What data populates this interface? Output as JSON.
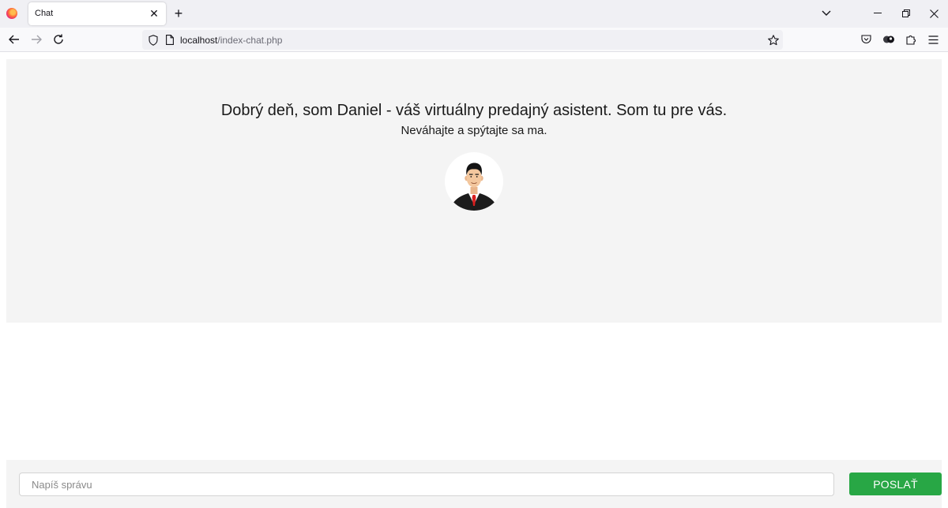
{
  "browser": {
    "tab_title": "Chat",
    "url_host": "localhost",
    "url_path": "/index-chat.php"
  },
  "chat": {
    "welcome_line1": "Dobrý deň, som Daniel - váš virtuálny predajný asistent. Som tu pre vás.",
    "welcome_line2": "Neváhajte a spýtajte sa ma."
  },
  "composer": {
    "placeholder": "Napíš správu",
    "value": "",
    "send_label": "POSLAŤ",
    "send_color": "#28a745"
  },
  "icons": {
    "tab_close": "close-icon",
    "new_tab": "plus-icon",
    "tab_list": "chevron-down-icon",
    "back": "arrow-left-icon",
    "forward": "arrow-right-icon",
    "reload": "reload-icon",
    "shield": "shield-icon",
    "page": "page-icon",
    "bookmark": "star-icon",
    "pocket": "pocket-icon",
    "account": "account-icon",
    "extensions": "puzzle-icon",
    "menu": "hamburger-icon"
  }
}
